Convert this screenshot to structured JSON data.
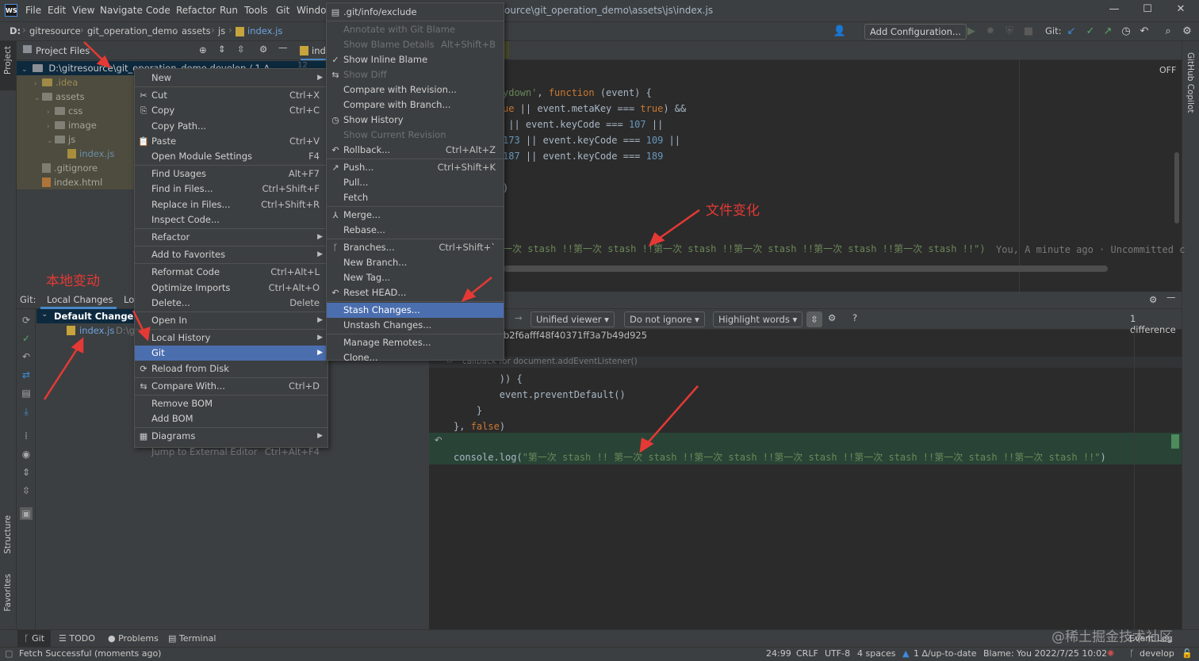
{
  "app": {
    "logo_text": "WS",
    "menu": [
      "File",
      "Edit",
      "View",
      "Navigate",
      "Code",
      "Refactor",
      "Run",
      "Tools",
      "Git",
      "Windo"
    ],
    "window_title": "ource\\git_operation_demo\\assets\\js\\index.js",
    "window_controls": [
      "—",
      "☐",
      "✕"
    ]
  },
  "navbar": {
    "crumbs": [
      "D:",
      "gitresource",
      "git_operation_demo",
      "assets",
      "js",
      "index.js"
    ],
    "add_config": "Add Configuration...",
    "git_label": "Git:"
  },
  "left_strip": {
    "project": "Project",
    "structure": "Structure",
    "favorites": "Favorites"
  },
  "right_strip": {
    "copilot": "GitHub Copilot"
  },
  "project": {
    "title": "Project Files",
    "root": "D:\\gitresource\\git_operation_demo  develop / 1 ∆",
    "tree": [
      {
        "label": ".idea",
        "indent": 1,
        "kind": "folder-y",
        "arrow": "›"
      },
      {
        "label": "assets",
        "indent": 1,
        "kind": "folder",
        "arrow": "⌄"
      },
      {
        "label": "css",
        "indent": 2,
        "kind": "folder",
        "arrow": "›"
      },
      {
        "label": "image",
        "indent": 2,
        "kind": "folder",
        "arrow": "›"
      },
      {
        "label": "js",
        "indent": 2,
        "kind": "folder",
        "arrow": "⌄"
      },
      {
        "label": "index.js",
        "indent": 3,
        "kind": "js",
        "arrow": ""
      },
      {
        "label": ".gitignore",
        "indent": 1,
        "kind": "git",
        "arrow": ""
      },
      {
        "label": "index.html",
        "indent": 1,
        "kind": "html",
        "arrow": ""
      }
    ]
  },
  "editor": {
    "tab_label": "ind",
    "off_label": "OFF",
    "line_marker": "12",
    "blame": "You, A minute ago · Uncommitted c",
    "stash_log": "一次 stash !!第一次 stash !!第一次 stash !!第一次 stash !!第一次 stash !!第一次 stash !!\")"
  },
  "annotations": {
    "file_change": "文件变化",
    "local_change": "本地变动"
  },
  "git_panel": {
    "tabs": [
      "Git:",
      "Local Changes",
      "Lo"
    ],
    "changelist": "Default Changelist",
    "file": "index.js",
    "file_path": "D:\\gi"
  },
  "diff": {
    "viewer": "Unified viewer",
    "ignore": "Do not ignore",
    "highlight": "Highlight words",
    "differences": "1 difference",
    "hash": "b2f6afff48f40371ff3a7b49d925",
    "fold": "callback for document.addEventListener()",
    "line1": "        )) {",
    "line2": "        event.preventDefault()",
    "line3": "    }",
    "line4a": "}, ",
    "line4b": "false",
    "line4c": ")",
    "log_prefix": "console.log(",
    "log_str": "\"第一次 stash !! 第一次 stash !!第一次 stash !!第一次 stash !!第一次 stash !!第一次 stash !!第一次 stash !!\"",
    "log_suffix": ")"
  },
  "context_menu": [
    {
      "label": "New",
      "sub": true
    },
    {
      "sep": true
    },
    {
      "icon": "✂",
      "label": "Cut",
      "shortcut": "Ctrl+X"
    },
    {
      "icon": "⎘",
      "label": "Copy",
      "shortcut": "Ctrl+C"
    },
    {
      "label": "Copy Path..."
    },
    {
      "icon": "📋",
      "label": "Paste",
      "shortcut": "Ctrl+V"
    },
    {
      "label": "Open Module Settings",
      "shortcut": "F4"
    },
    {
      "sep": true
    },
    {
      "label": "Find Usages",
      "shortcut": "Alt+F7"
    },
    {
      "label": "Find in Files...",
      "shortcut": "Ctrl+Shift+F"
    },
    {
      "label": "Replace in Files...",
      "shortcut": "Ctrl+Shift+R"
    },
    {
      "label": "Inspect Code..."
    },
    {
      "sep": true
    },
    {
      "label": "Refactor",
      "sub": true
    },
    {
      "sep": true
    },
    {
      "label": "Add to Favorites",
      "sub": true
    },
    {
      "sep": true
    },
    {
      "label": "Reformat Code",
      "shortcut": "Ctrl+Alt+L"
    },
    {
      "label": "Optimize Imports",
      "shortcut": "Ctrl+Alt+O"
    },
    {
      "label": "Delete...",
      "shortcut": "Delete"
    },
    {
      "sep": true
    },
    {
      "label": "Open In",
      "sub": true
    },
    {
      "sep": true
    },
    {
      "label": "Local History",
      "sub": true
    },
    {
      "label": "Git",
      "sub": true,
      "selected": true
    },
    {
      "icon": "⟳",
      "label": "Reload from Disk"
    },
    {
      "sep": true
    },
    {
      "icon": "⇆",
      "label": "Compare With...",
      "shortcut": "Ctrl+D"
    },
    {
      "sep": true
    },
    {
      "label": "Remove BOM"
    },
    {
      "label": "Add BOM"
    },
    {
      "sep": true
    },
    {
      "icon": "▦",
      "label": "Diagrams",
      "sub": true
    },
    {
      "label": "Jump to External Editor",
      "shortcut": "Ctrl+Alt+F4",
      "disabled": true
    }
  ],
  "git_submenu": [
    {
      "icon": "▤",
      "label": ".git/info/exclude"
    },
    {
      "sep": true
    },
    {
      "label": "Annotate with Git Blame",
      "disabled": true
    },
    {
      "label": "Show Blame Details",
      "shortcut": "Alt+Shift+B",
      "disabled": true
    },
    {
      "icon": "✓",
      "label": "Show Inline Blame"
    },
    {
      "icon": "⇆",
      "label": "Show Diff",
      "disabled": true
    },
    {
      "label": "Compare with Revision..."
    },
    {
      "label": "Compare with Branch..."
    },
    {
      "icon": "◷",
      "label": "Show History"
    },
    {
      "label": "Show Current Revision",
      "disabled": true
    },
    {
      "icon": "↶",
      "label": "Rollback...",
      "shortcut": "Ctrl+Alt+Z"
    },
    {
      "sep": true
    },
    {
      "icon": "↗",
      "label": "Push...",
      "shortcut": "Ctrl+Shift+K"
    },
    {
      "label": "Pull..."
    },
    {
      "label": "Fetch"
    },
    {
      "sep": true
    },
    {
      "icon": "⅄",
      "label": "Merge..."
    },
    {
      "label": "Rebase..."
    },
    {
      "sep": true
    },
    {
      "icon": "ᚴ",
      "label": "Branches...",
      "shortcut": "Ctrl+Shift+`"
    },
    {
      "label": "New Branch..."
    },
    {
      "label": "New Tag..."
    },
    {
      "icon": "↶",
      "label": "Reset HEAD..."
    },
    {
      "sep": true
    },
    {
      "label": "Stash Changes...",
      "selected": true
    },
    {
      "label": "Unstash Changes..."
    },
    {
      "sep": true
    },
    {
      "label": "Manage Remotes..."
    },
    {
      "label": "Clone..."
    }
  ],
  "bottom_tabs": [
    "Git",
    "TODO",
    "Problems",
    "Terminal"
  ],
  "event_log": "Event Log",
  "watermark": "@稀土掘金技术社区",
  "status": {
    "message": "Fetch Successful (moments ago)",
    "pos": "24:99",
    "crlf": "CRLF",
    "enc": "UTF-8",
    "indent": "4 spaces",
    "updates": "1 ∆/up-to-date",
    "blame": "Blame: You 2022/7/25 10:02",
    "branch": "develop"
  },
  "colors": {
    "selection": "#4b6eaf",
    "accent": "#e53935",
    "added": "#294436"
  }
}
